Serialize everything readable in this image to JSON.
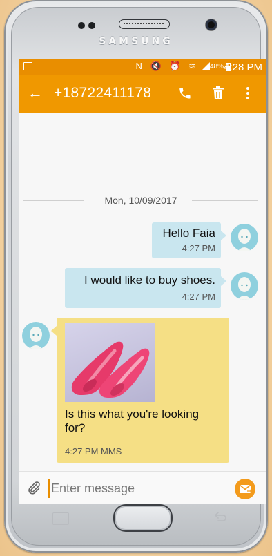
{
  "device": {
    "brand": "SAMSUNG"
  },
  "status_bar": {
    "battery_percent": "48%",
    "time": "4:28 PM",
    "icons_text": "N 🔇 ⏰ ≋"
  },
  "app_bar": {
    "title": "+18722411178"
  },
  "conversation": {
    "date_separator": "Mon, 10/09/2017",
    "messages": [
      {
        "direction": "outgoing",
        "text": "Hello Faia",
        "time": "4:27 PM"
      },
      {
        "direction": "outgoing",
        "text": "I would like to buy shoes.",
        "time": "4:27 PM"
      },
      {
        "direction": "incoming",
        "image": "pink-flat-shoes",
        "text_line1": "Is this what you're looking",
        "text_line2": "for?",
        "time": "4:27 PM MMS"
      }
    ]
  },
  "compose": {
    "placeholder": "Enter message",
    "value": ""
  },
  "colors": {
    "status_bar": "#e98e00",
    "app_bar": "#f09800",
    "outgoing_bubble": "#c9e6ef",
    "incoming_bubble": "#f5df85",
    "send_button": "#f39b1c"
  },
  "icons": {
    "back": "back-arrow-icon",
    "call": "phone-icon",
    "delete": "trash-icon",
    "more": "more-vert-icon",
    "attach": "paperclip-icon",
    "send": "send-message-icon"
  }
}
